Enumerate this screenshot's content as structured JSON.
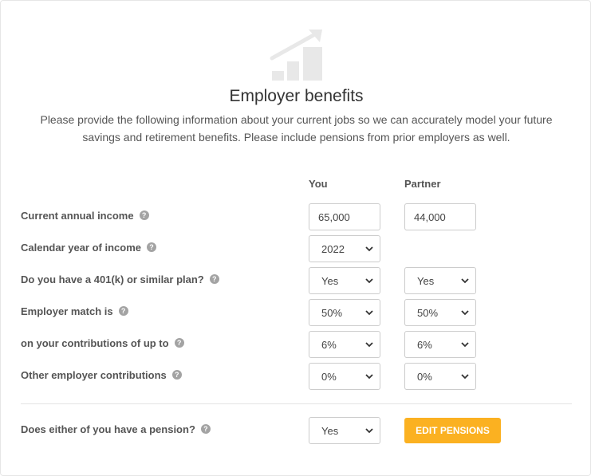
{
  "header": {
    "icon": "growth-chart-icon",
    "title": "Employer benefits",
    "description": "Please provide the following information about your current jobs so we can accurately model your future savings and retirement benefits. Please include pensions from prior employers as well."
  },
  "columns": {
    "you": "You",
    "partner": "Partner"
  },
  "rows": {
    "income": {
      "label": "Current annual income",
      "you": "65,000",
      "partner": "44,000"
    },
    "year": {
      "label": "Calendar year of income",
      "you": "2022"
    },
    "plan": {
      "label": "Do you have a 401(k) or similar plan?",
      "you": "Yes",
      "partner": "Yes"
    },
    "match": {
      "label": "Employer match is",
      "you": "50%",
      "partner": "50%"
    },
    "upto": {
      "label": "on your contributions of up to",
      "you": "6%",
      "partner": "6%"
    },
    "other": {
      "label": "Other employer contributions",
      "you": "0%",
      "partner": "0%"
    }
  },
  "pension": {
    "label": "Does either of you have a pension?",
    "you": "Yes",
    "button": "EDIT PENSIONS"
  },
  "help_glyph": "?",
  "colors": {
    "accent": "#fbb121",
    "icon": "#e6e6e6",
    "help": "#a3a3a3"
  }
}
